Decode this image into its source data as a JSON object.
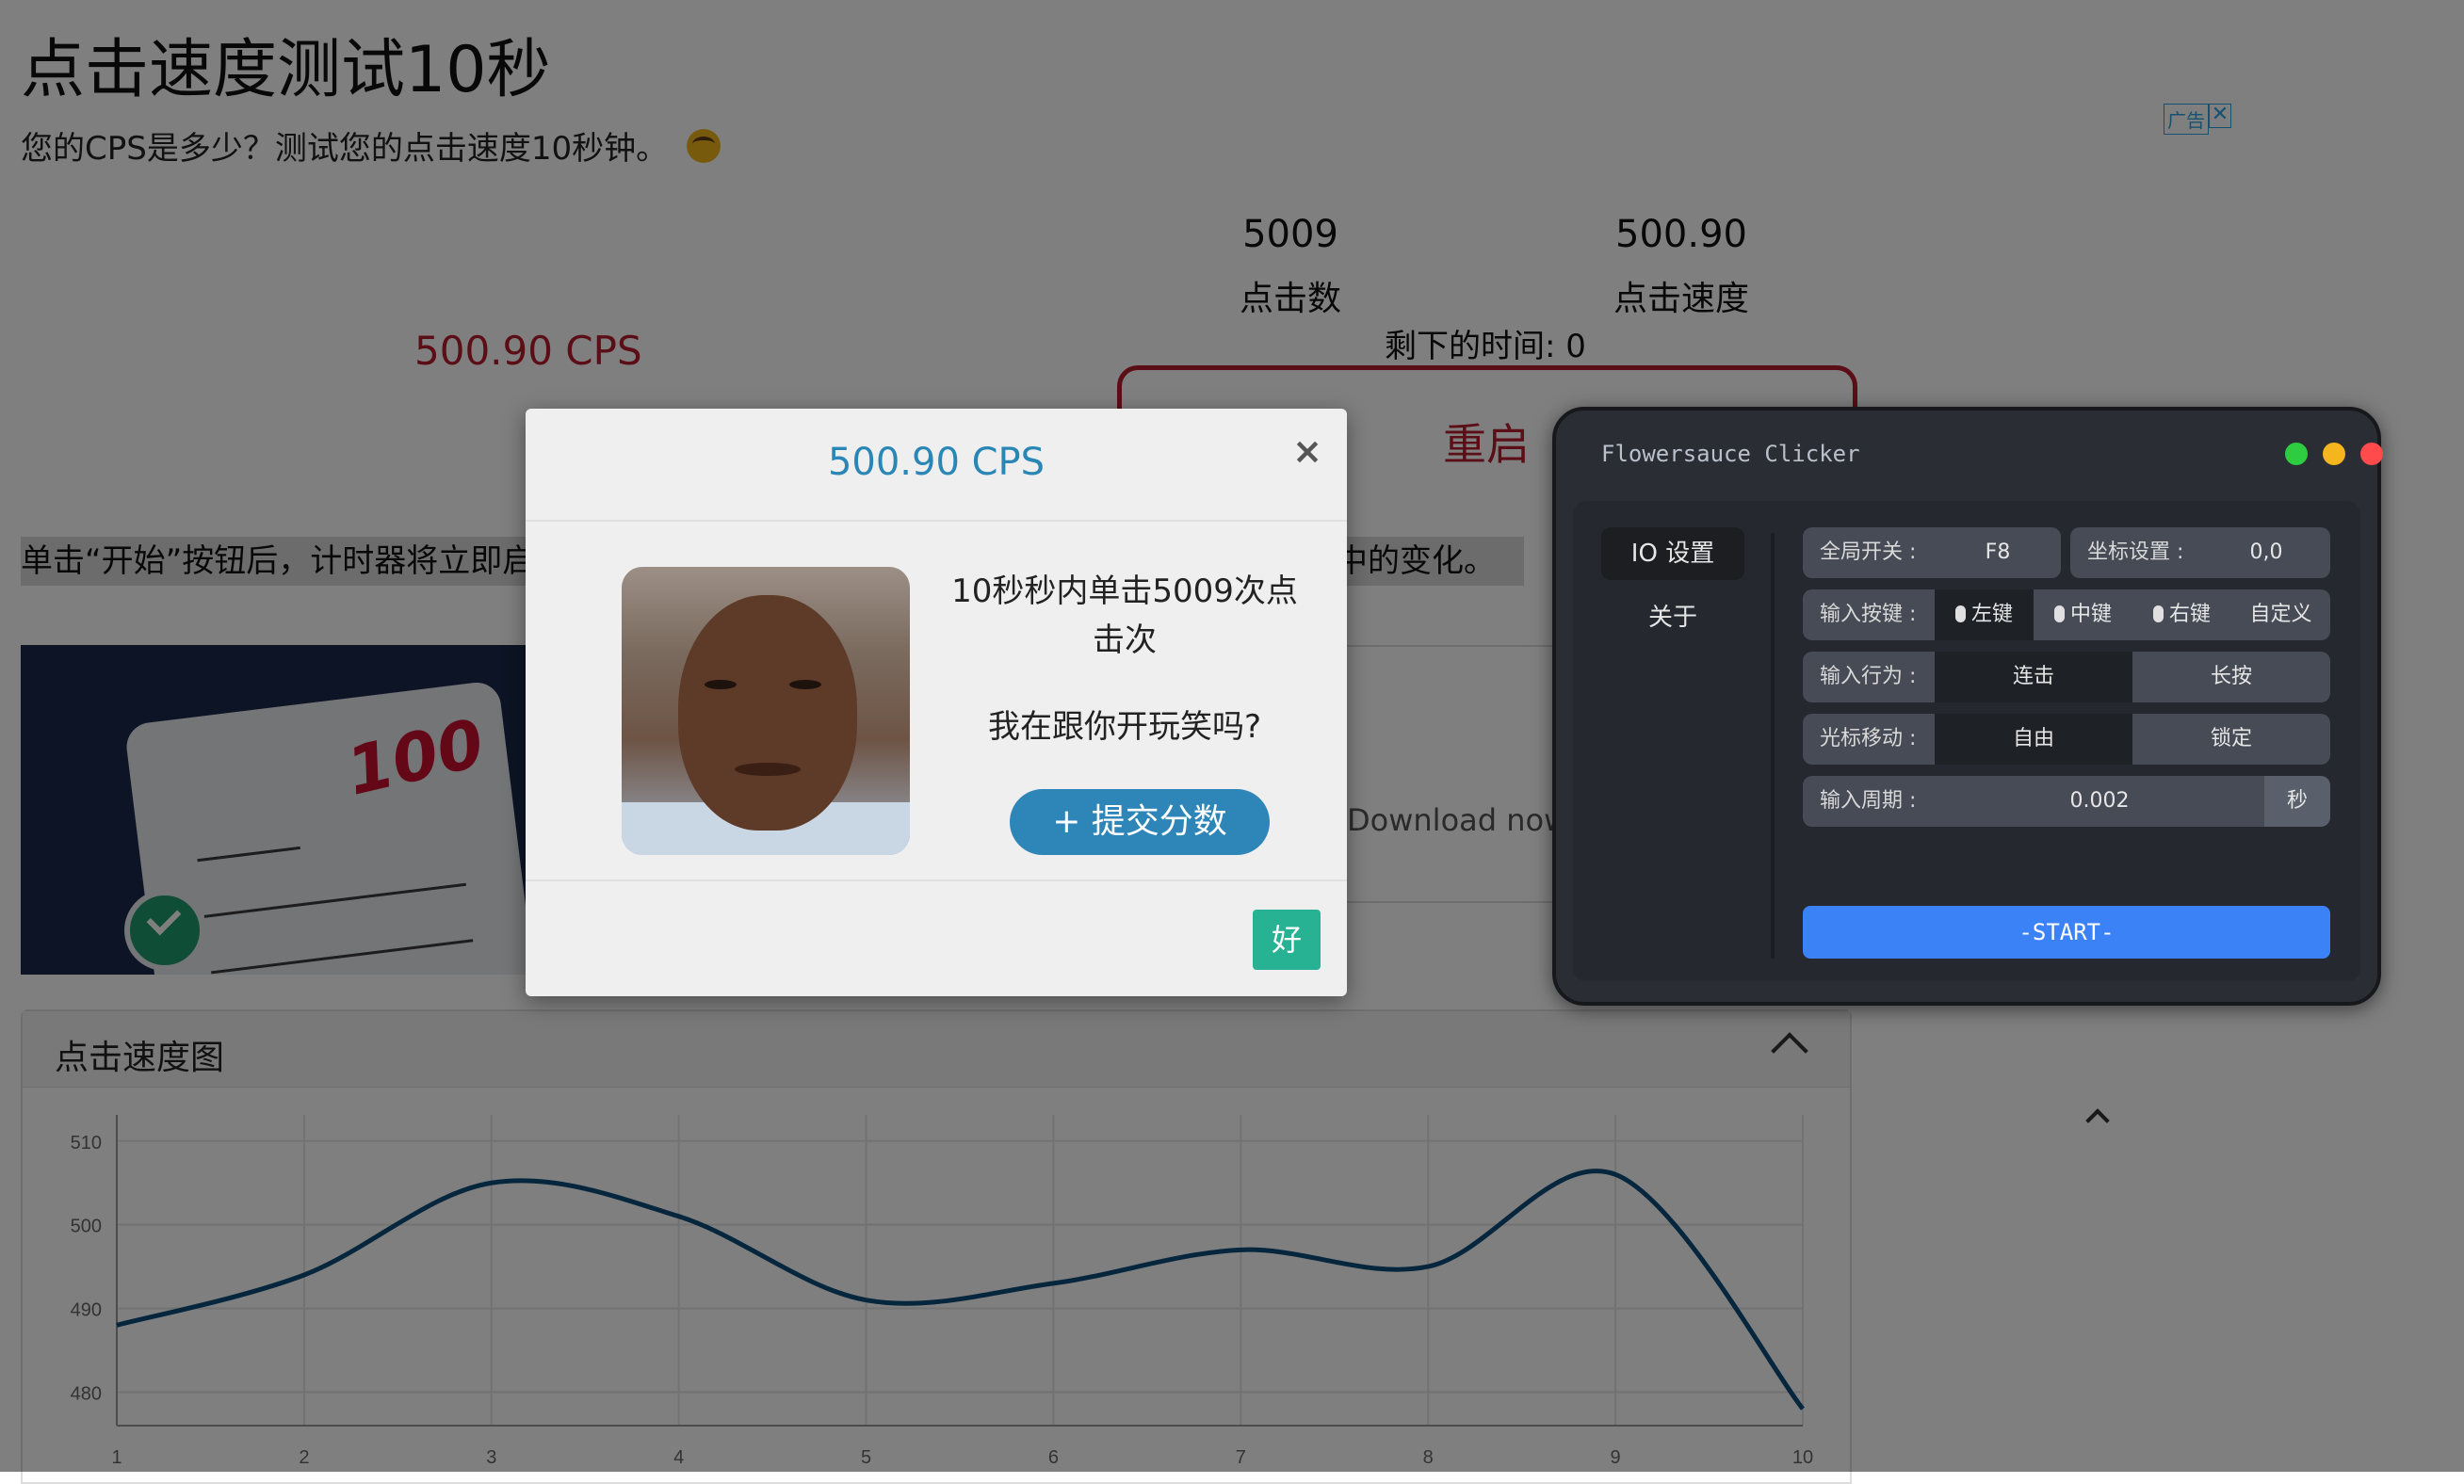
{
  "page": {
    "title": "点击速度测试10秒",
    "subtitle": "您的CPS是多少？测试您的点击速度10秒钟。",
    "ad_label": "广告",
    "ad_close": "✕",
    "cps_display": "500.90 CPS",
    "stats": {
      "clicks_value": "5009",
      "clicks_label": "点击数",
      "speed_value": "500.90",
      "speed_label": "点击速度"
    },
    "time_left": "剩下的时间: 0",
    "restart_label": "重启",
    "instruction_left": "单击“开始”按钮后，计时器将立即启",
    "instruction_right": "程中的变化。",
    "download_text": "Download now.",
    "chart_panel_title": "点击速度图"
  },
  "modal": {
    "title": "500.90 CPS",
    "close": "×",
    "message": "10秒秒内单击5009次点击次",
    "joke": "我在跟你开玩笑吗?",
    "submit_label": "+ 提交分数",
    "ok_label": "好"
  },
  "clicker": {
    "title": "Flowersauce Clicker",
    "window_dots": [
      "#2ecc40",
      "#f5b51c",
      "#ff4b4b"
    ],
    "nav": [
      "IO 设置",
      "关于"
    ],
    "rows": {
      "global_switch": {
        "label": "全局开关 :",
        "value": "F8"
      },
      "coord": {
        "label": "坐标设置 :",
        "value": "0,0"
      },
      "input_key": {
        "label": "输入按键 :",
        "options": [
          "左键",
          "中键",
          "右键",
          "自定义"
        ]
      },
      "behavior": {
        "label": "输入行为 :",
        "options": [
          "连击",
          "长按"
        ]
      },
      "cursor": {
        "label": "光标移动 :",
        "options": [
          "自由",
          "锁定"
        ]
      },
      "period": {
        "label": "输入周期 :",
        "value": "0.002",
        "unit": "秒"
      }
    },
    "start_label": "-START-",
    "accent": "#3b82f6"
  },
  "chart_data": {
    "type": "line",
    "x": [
      1,
      2,
      3,
      4,
      5,
      6,
      7,
      8,
      9,
      10
    ],
    "y_ticks": [
      480,
      490,
      500,
      510
    ],
    "x_ticks": [
      1,
      2,
      3,
      4,
      5,
      6,
      7,
      8,
      9,
      10
    ],
    "ylim": [
      476,
      512
    ],
    "xlim": [
      1,
      10
    ],
    "series": [
      {
        "values": [
          488,
          494,
          505,
          501,
          491,
          493,
          497,
          495,
          506,
          478
        ],
        "color": "#0b4d7a"
      }
    ],
    "grid": true
  }
}
